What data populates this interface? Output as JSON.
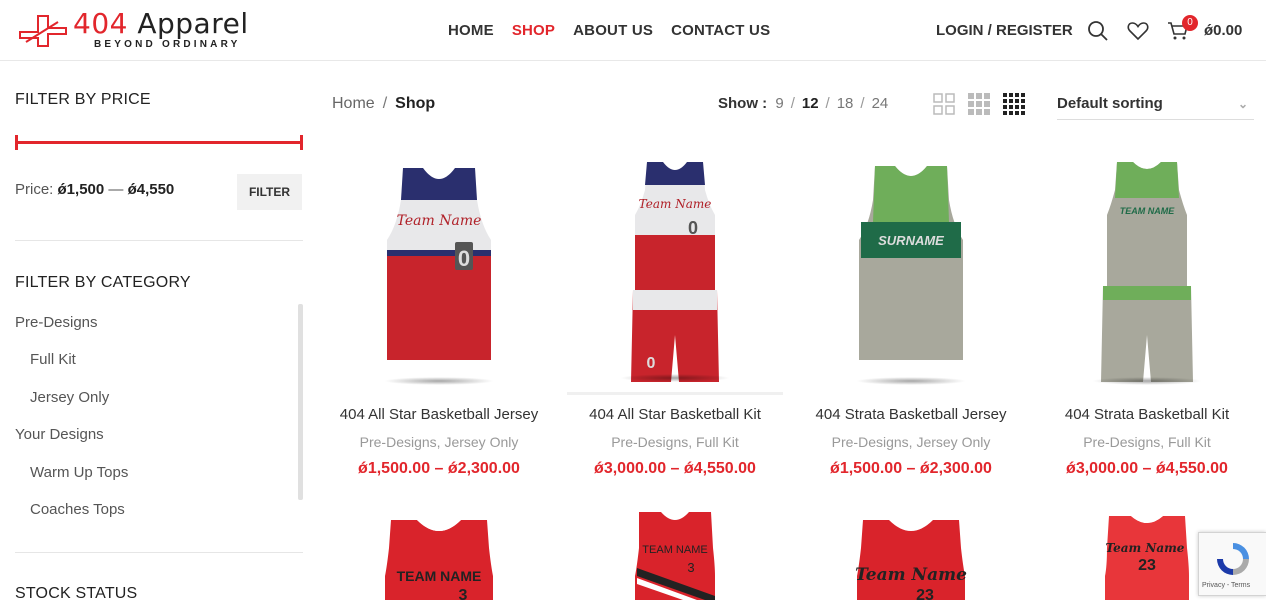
{
  "brand": {
    "logo_number": "404",
    "logo_word": "Apparel",
    "tagline": "BEYOND ORDINARY",
    "accent_color": "#e2262c"
  },
  "nav": {
    "items": [
      "HOME",
      "SHOP",
      "ABOUT US",
      "CONTACT US"
    ],
    "active": "SHOP"
  },
  "header": {
    "login_label": "LOGIN / REGISTER",
    "cart_count": "0",
    "cart_total": "ǿ0.00",
    "icons": [
      "search-icon",
      "heart-icon",
      "cart-icon"
    ]
  },
  "sidebar": {
    "price_title": "FILTER BY PRICE",
    "price_prefix": "Price:",
    "price_min": "ǿ1,500",
    "price_sep": "—",
    "price_max": "ǿ4,550",
    "filter_label": "FILTER",
    "category_title": "FILTER BY CATEGORY",
    "categories": [
      {
        "label": "Pre-Designs",
        "level": 0
      },
      {
        "label": "Full Kit",
        "level": 1
      },
      {
        "label": "Jersey Only",
        "level": 1
      },
      {
        "label": "Your Designs",
        "level": 0
      },
      {
        "label": "Warm Up Tops",
        "level": 1
      },
      {
        "label": "Coaches Tops",
        "level": 1
      }
    ],
    "stock_title": "STOCK STATUS"
  },
  "breadcrumb": {
    "home": "Home",
    "sep": "/",
    "current": "Shop"
  },
  "toolbar": {
    "show_label": "Show :",
    "show_options": [
      "9",
      "12",
      "18",
      "24"
    ],
    "show_selected": "12",
    "sort_label": "Default sorting",
    "grid_icons": [
      "grid-2-icon",
      "grid-3-icon",
      "grid-4-icon"
    ]
  },
  "products": [
    {
      "name": "404 All Star Basketball Jersey",
      "category": "Pre-Designs, Jersey Only",
      "price": "ǿ1,500.00 – ǿ2,300.00",
      "jersey_text": "Team Name",
      "number": "0"
    },
    {
      "name": "404 All Star Basketball Kit",
      "category": "Pre-Designs, Full Kit",
      "price": "ǿ3,000.00 – ǿ4,550.00",
      "jersey_text": "Team Name",
      "number": "0"
    },
    {
      "name": "404 Strata Basketball Jersey",
      "category": "Pre-Designs, Jersey Only",
      "price": "ǿ1,500.00 – ǿ2,300.00",
      "jersey_text": "SURNAME",
      "number": ""
    },
    {
      "name": "404 Strata Basketball Kit",
      "category": "Pre-Designs, Full Kit",
      "price": "ǿ3,000.00 – ǿ4,550.00",
      "jersey_text": "TEAM NAME",
      "number": ""
    }
  ],
  "products_row2": [
    {
      "jersey_text": "TEAM NAME",
      "number": "3"
    },
    {
      "jersey_text": "TEAM NAME",
      "number": "3"
    },
    {
      "jersey_text": "Team Name",
      "number": "23"
    },
    {
      "jersey_text": "Team Name",
      "number": "23"
    }
  ],
  "recaptcha": {
    "text": "Privacy - Terms"
  }
}
